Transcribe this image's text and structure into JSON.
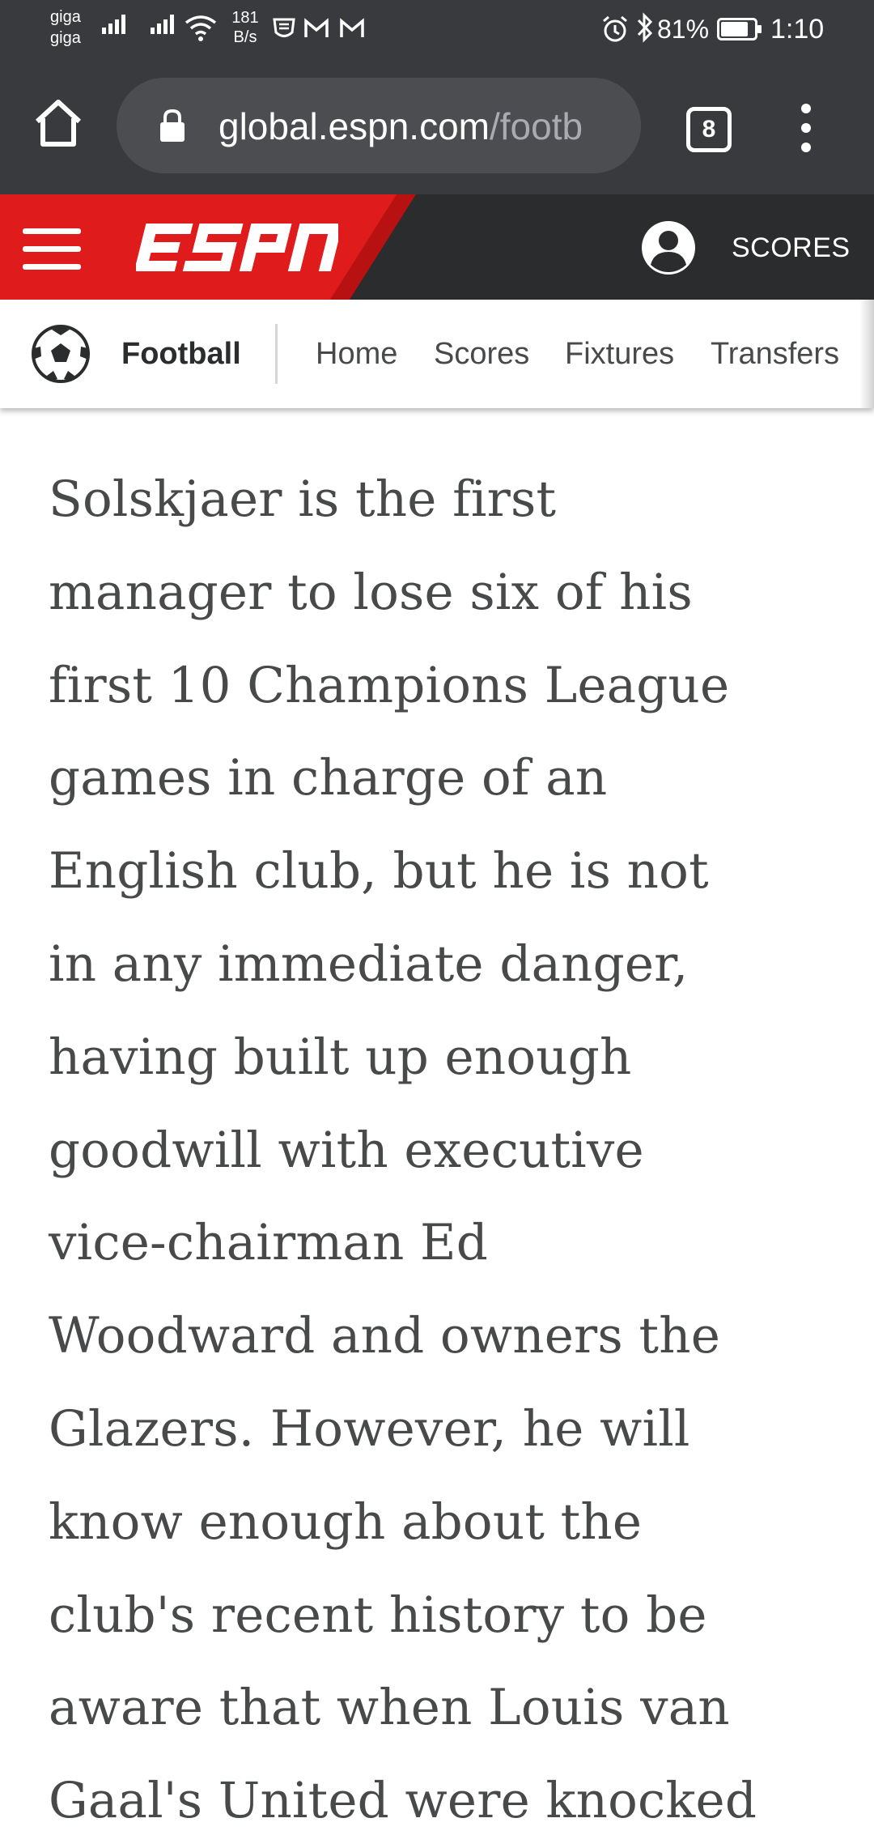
{
  "status_bar": {
    "carrier_line1": "giga",
    "carrier_line2": "giga",
    "speed_value": "181",
    "speed_unit": "B/s",
    "battery_percent": "81%",
    "time": "1:10"
  },
  "browser": {
    "url_domain": "global.espn.com",
    "url_path": "/footb",
    "tab_count": "8"
  },
  "espn_header": {
    "logo_text": "ESPN",
    "scores_label": "SCORES",
    "brand_red": "#e01b1b"
  },
  "subnav": {
    "sport_label": "Football",
    "items": [
      {
        "label": "Home"
      },
      {
        "label": "Scores"
      },
      {
        "label": "Fixtures"
      },
      {
        "label": "Transfers"
      }
    ]
  },
  "article": {
    "lines": [
      "Solskjaer is the first",
      "manager to lose six of his",
      "first 10 Champions League",
      "games in charge of an",
      "English club, but he is not",
      "in any immediate danger,",
      "having built up enough",
      "goodwill with executive",
      "vice-chairman Ed",
      "Woodward and owners the",
      "Glazers. However, he will",
      "know enough about the",
      "club's recent history to be",
      "aware that when Louis van",
      "Gaal's United were knocked"
    ]
  }
}
